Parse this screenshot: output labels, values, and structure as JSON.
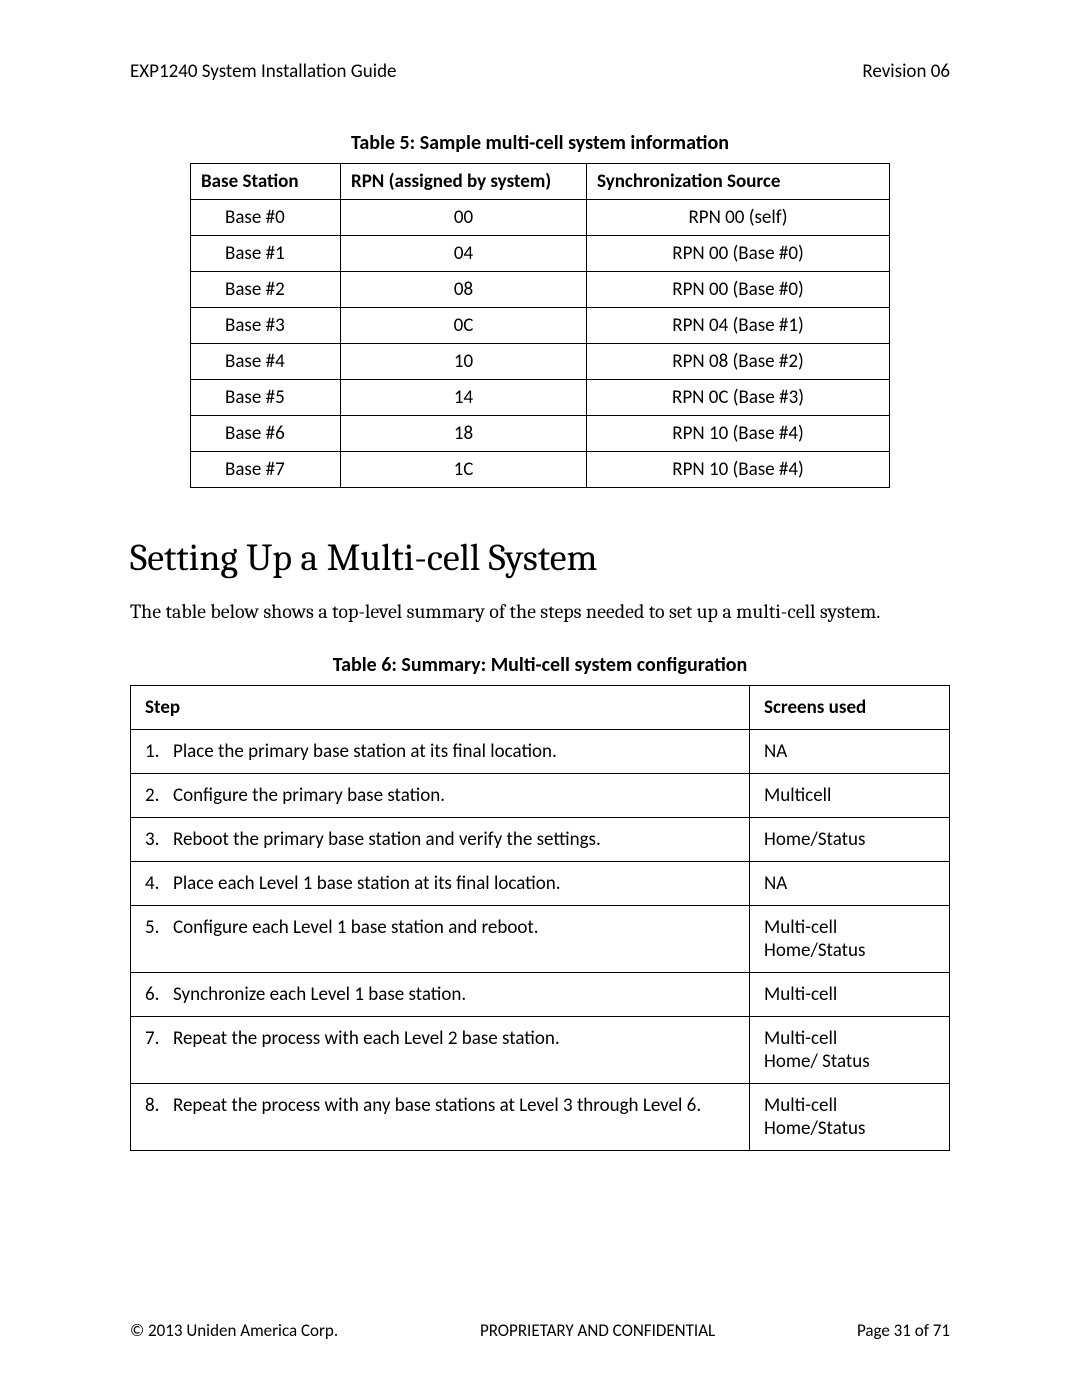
{
  "header": {
    "left": "EXP1240 System Installation Guide",
    "right": "Revision 06"
  },
  "table5": {
    "caption": "Table 5: Sample multi-cell system information",
    "headers": {
      "c0": "Base Station",
      "c1": "RPN (assigned by system)",
      "c2": "Synchronization Source"
    },
    "rows": [
      {
        "base": "Base #0",
        "rpn": "00",
        "sync": "RPN 00 (self)"
      },
      {
        "base": "Base #1",
        "rpn": "04",
        "sync": "RPN 00 (Base #0)"
      },
      {
        "base": "Base #2",
        "rpn": "08",
        "sync": "RPN 00 (Base #0)"
      },
      {
        "base": "Base #3",
        "rpn": "0C",
        "sync": "RPN 04 (Base #1)"
      },
      {
        "base": "Base #4",
        "rpn": "10",
        "sync": "RPN 08 (Base #2)"
      },
      {
        "base": "Base #5",
        "rpn": "14",
        "sync": "RPN 0C (Base #3)"
      },
      {
        "base": "Base #6",
        "rpn": "18",
        "sync": "RPN 10 (Base #4)"
      },
      {
        "base": "Base #7",
        "rpn": "1C",
        "sync": "RPN 10 (Base #4)"
      }
    ]
  },
  "section": {
    "heading": "Setting Up a Multi-cell System",
    "intro": "The table below shows a top-level summary of the steps needed to set up a multi-cell system."
  },
  "table6": {
    "caption": "Table 6: Summary: Multi-cell system configuration",
    "headers": {
      "c0": "Step",
      "c1": "Screens used"
    },
    "rows": [
      {
        "num": "1.",
        "text": "Place the primary base station at its final location.",
        "screen": "NA"
      },
      {
        "num": "2.",
        "text": "Configure the primary base station.",
        "screen": "Multicell"
      },
      {
        "num": "3.",
        "text": "Reboot the primary base station and verify the settings.",
        "screen": "Home/Status"
      },
      {
        "num": "4.",
        "text": "Place each Level 1 base station at its final location.",
        "screen": "NA"
      },
      {
        "num": "5.",
        "text": "Configure each Level 1 base station and reboot.",
        "screen": "Multi-cell\nHome/Status"
      },
      {
        "num": "6.",
        "text": "Synchronize each Level 1 base station.",
        "screen": "Multi-cell"
      },
      {
        "num": "7.",
        "text": "Repeat the process with each Level 2 base station.",
        "screen": "Multi-cell\nHome/ Status"
      },
      {
        "num": "8.",
        "text": "Repeat the process with any base stations at Level 3 through Level 6.",
        "screen": "Multi-cell\nHome/Status"
      }
    ]
  },
  "footer": {
    "left": "© 2013 Uniden America Corp.",
    "mid": "PROPRIETARY AND CONFIDENTIAL",
    "right": "Page 31 of 71"
  }
}
